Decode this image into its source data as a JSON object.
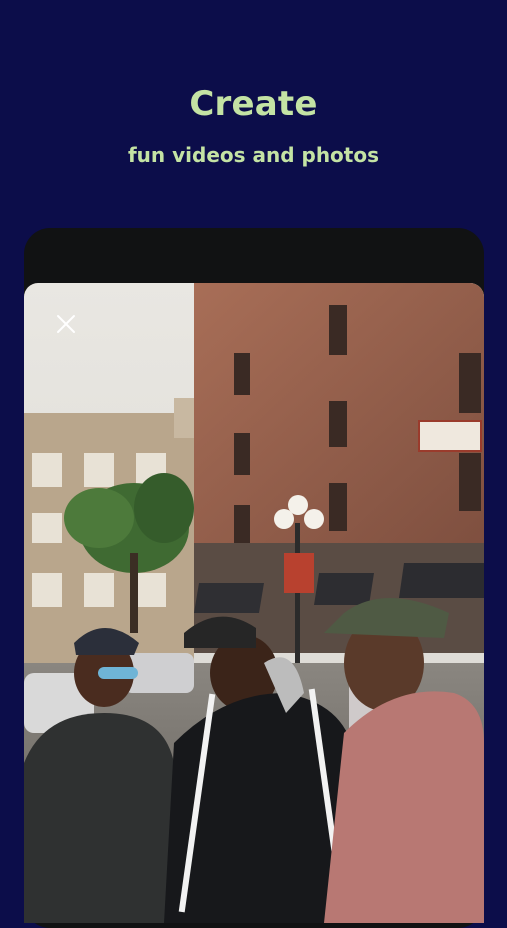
{
  "onboarding": {
    "title": "Create",
    "subtitle": "fun videos and photos"
  },
  "preview": {
    "close_icon": "close-icon",
    "image_description_icon": "photo-preview"
  },
  "colors": {
    "background": "#0c0d4a",
    "accent_text": "#c4e3a4",
    "frame": "#111213"
  }
}
